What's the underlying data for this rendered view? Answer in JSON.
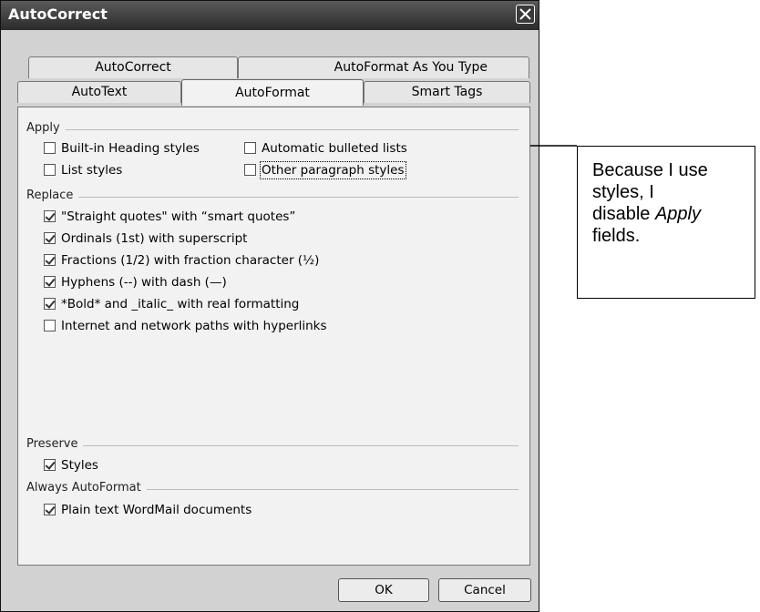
{
  "dialog": {
    "title": "AutoCorrect",
    "tabs": {
      "autocorrect": "AutoCorrect",
      "autoformat_as_you_type": "AutoFormat As You Type",
      "autotext": "AutoText",
      "autoformat": "AutoFormat",
      "smart_tags": "Smart Tags"
    },
    "groups": {
      "apply": {
        "label": "Apply",
        "options": [
          {
            "label": "Built-in Heading styles",
            "checked": false
          },
          {
            "label": "Automatic bulleted lists",
            "checked": false
          },
          {
            "label": "List styles",
            "checked": false
          },
          {
            "label": "Other paragraph styles",
            "checked": false
          }
        ]
      },
      "replace": {
        "label": "Replace",
        "options": [
          {
            "label": "\"Straight quotes\" with “smart quotes”",
            "checked": true
          },
          {
            "label": "Ordinals (1st) with superscript",
            "checked": true
          },
          {
            "label": "Fractions (1/2) with fraction character (½)",
            "checked": true
          },
          {
            "label": "Hyphens (--) with dash (—)",
            "checked": true
          },
          {
            "label": "*Bold* and _italic_ with real formatting",
            "checked": true
          },
          {
            "label": "Internet and network paths with hyperlinks",
            "checked": false
          }
        ]
      },
      "preserve": {
        "label": "Preserve",
        "options": [
          {
            "label": "Styles",
            "checked": true
          }
        ]
      },
      "always": {
        "label": "Always AutoFormat",
        "options": [
          {
            "label": "Plain text WordMail documents",
            "checked": true
          }
        ]
      }
    },
    "buttons": {
      "ok": "OK",
      "cancel": "Cancel"
    }
  },
  "callout": {
    "line1": "Because I use",
    "line2": "styles, I",
    "line3_pre": "disable ",
    "line3_em": "Apply",
    "line4": "fields."
  },
  "icons": {
    "close": "close-icon",
    "check": "checkmark-icon",
    "arrow": "arrow-left-icon"
  }
}
